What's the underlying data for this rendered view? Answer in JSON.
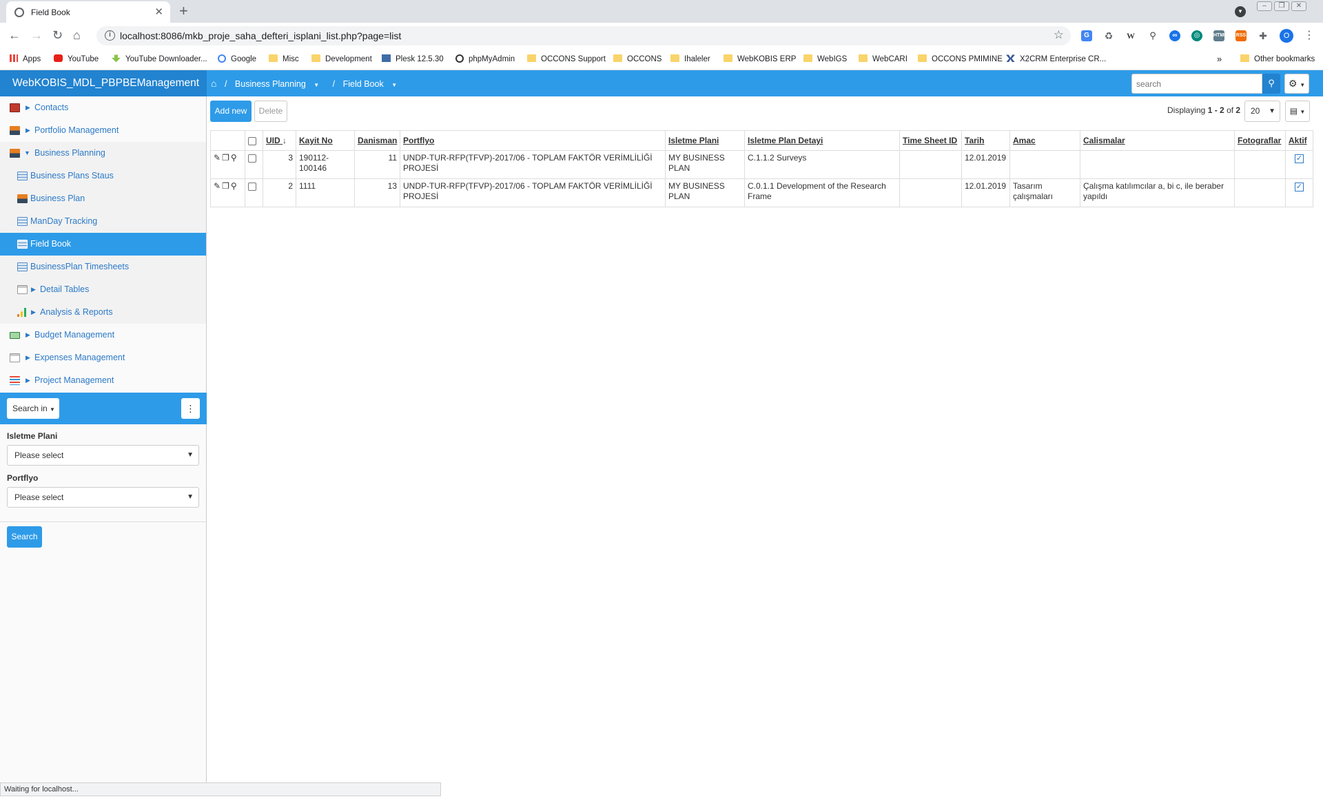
{
  "browser": {
    "tab_title": "Field Book",
    "url": "localhost:8086/mkb_proje_saha_defteri_isplani_list.php?page=list",
    "bookmarks": [
      "Apps",
      "YouTube",
      "YouTube Downloader...",
      "Google",
      "Misc",
      "Development",
      "Plesk 12.5.30",
      "phpMyAdmin",
      "OCCONS Support",
      "OCCONS",
      "Ihaleler",
      "WebKOBIS ERP",
      "WebIGS",
      "WebCARI",
      "OCCONS PMIMINE",
      "X2CRM Enterprise CR..."
    ],
    "other_bookmarks": "Other bookmarks",
    "profile_initial": "O",
    "status_text": "Waiting for localhost..."
  },
  "app": {
    "title": "WebKOBIS_MDL_PBPBEManagement",
    "breadcrumb": {
      "separator": "/",
      "section": "Business Planning",
      "page": "Field Book"
    },
    "search_placeholder": "search"
  },
  "sidebar": {
    "items": [
      {
        "label": "Contacts",
        "icon": "contacts-icon"
      },
      {
        "label": "Portfolio Management",
        "icon": "portfolio-icon"
      },
      {
        "label": "Business Planning",
        "icon": "business-planning-icon"
      },
      {
        "label": "Business Plans Staus",
        "icon": "table-icon"
      },
      {
        "label": "Business Plan",
        "icon": "business-plan-icon"
      },
      {
        "label": "ManDay Tracking",
        "icon": "table-icon"
      },
      {
        "label": "Field Book",
        "icon": "table-icon"
      },
      {
        "label": "BusinessPlan Timesheets",
        "icon": "table-icon"
      },
      {
        "label": "Detail Tables",
        "icon": "page-icon"
      },
      {
        "label": "Analysis & Reports",
        "icon": "chart-icon"
      },
      {
        "label": "Budget Management",
        "icon": "budget-icon"
      },
      {
        "label": "Expenses Management",
        "icon": "page-icon"
      },
      {
        "label": "Project Management",
        "icon": "project-icon"
      }
    ]
  },
  "search_panel": {
    "search_in": "Search in",
    "fields": [
      {
        "label": "Isletme Plani",
        "value": "Please select"
      },
      {
        "label": "Portflyo",
        "value": "Please select"
      }
    ],
    "search_button": "Search"
  },
  "list": {
    "add_label": "Add new",
    "delete_label": "Delete",
    "display_prefix": "Displaying",
    "range": "1 - 2",
    "of_label": "of",
    "total": "2",
    "page_size": "20",
    "columns": [
      "UID",
      "Kayit No",
      "Danisman",
      "Portflyo",
      "Isletme Plani",
      "Isletme Plan Detayi",
      "Time Sheet ID",
      "Tarih",
      "Amac",
      "Calismalar",
      "Fotograflar",
      "Aktif"
    ],
    "rows": [
      {
        "uid": "3",
        "kayit_no": "190112-100146",
        "danisman": "11",
        "portflyo": "UNDP-TUR-RFP(TFVP)-2017/06 - TOPLAM FAKTÖR VERİMLİLİĞİ PROJESİ",
        "isletme_plani": "MY BUSINESS PLAN",
        "plan_detayi": "C.1.1.2 Surveys",
        "time_sheet_id": "",
        "tarih": "12.01.2019",
        "amac": "",
        "calismalar": "",
        "fotograflar": "",
        "aktif": true
      },
      {
        "uid": "2",
        "kayit_no": "1111",
        "danisman": "13",
        "portflyo": "UNDP-TUR-RFP(TFVP)-2017/06 - TOPLAM FAKTÖR VERİMLİLİĞİ PROJESİ",
        "isletme_plani": "MY BUSINESS PLAN",
        "plan_detayi": "C.0.1.1 Development of the Research Frame",
        "time_sheet_id": "",
        "tarih": "12.01.2019",
        "amac": "Tasarım çalışmaları",
        "calismalar": "Çalışma katılımcılar a, bi c, ile beraber yapıldı",
        "fotograflar": "",
        "aktif": true
      }
    ]
  }
}
